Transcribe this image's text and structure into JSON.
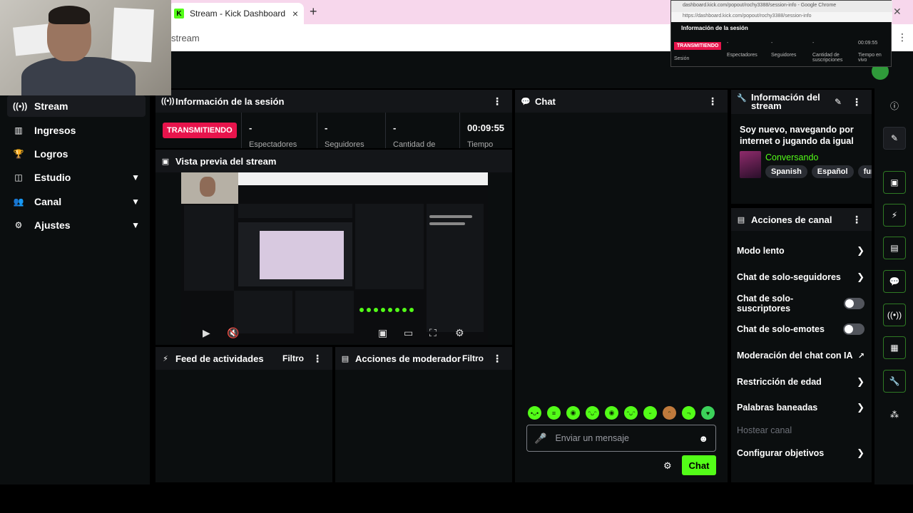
{
  "browser": {
    "tab_title": "Stream - Kick Dashboard",
    "tab_favicon": "K",
    "close": "×",
    "new_tab": "+",
    "url_fragment": "stream"
  },
  "popout": {
    "window_title": "dashboard.kick.com/popout/rochy3388/session-info - Google Chrome",
    "url": "https://dashboard.kick.com/popout/rochy3388/session-info",
    "header": "Información de la sesión",
    "status": "TRANSMITIENDO",
    "status_sub": "Sesión",
    "cells": [
      {
        "value": "-",
        "label": "Espectadores"
      },
      {
        "value": "-",
        "label": "Seguidores"
      },
      {
        "value": "-",
        "label": "Cantidad de suscripciones"
      },
      {
        "value": "00:09:55",
        "label": "Tiempo en vivo"
      }
    ]
  },
  "sidebar": {
    "items": [
      {
        "label": "Stream",
        "icon": "broadcast-icon",
        "glyph": "((•))"
      },
      {
        "label": "Ingresos",
        "icon": "chart-icon",
        "glyph": "▥"
      },
      {
        "label": "Logros",
        "icon": "trophy-icon",
        "glyph": "🏆"
      },
      {
        "label": "Estudio",
        "icon": "studio-icon",
        "glyph": "◫"
      },
      {
        "label": "Canal",
        "icon": "users-icon",
        "glyph": "👥"
      },
      {
        "label": "Ajustes",
        "icon": "gear-icon",
        "glyph": "⚙"
      }
    ]
  },
  "session": {
    "title": "Información de la sesión",
    "status": "TRANSMITIENDO",
    "cells": [
      {
        "value": "-",
        "label": "Espectadores"
      },
      {
        "value": "-",
        "label": "Seguidores"
      },
      {
        "value": "-",
        "label": "Cantidad de"
      },
      {
        "value": "00:09:55",
        "label": "Tiempo"
      }
    ]
  },
  "preview": {
    "title": "Vista previa del stream"
  },
  "activity": {
    "title": "Feed de actividades",
    "filter": "Filtro"
  },
  "moderator": {
    "title": "Acciones de moderador",
    "filter": "Filtro"
  },
  "chat": {
    "title": "Chat",
    "placeholder": "Enviar un mensaje",
    "send": "Chat",
    "emote_count": 10
  },
  "stream_info": {
    "title": "Información del stream",
    "stream_title": "Soy nuevo, navegando por internet o jugando da igual",
    "category": "Conversando",
    "tags": [
      "Spanish",
      "Español",
      "fur"
    ]
  },
  "channel_actions": {
    "title": "Acciones de canal",
    "items": [
      {
        "label": "Modo lento",
        "type": "chevron"
      },
      {
        "label": "Chat de solo-seguidores",
        "type": "chevron"
      },
      {
        "label": "Chat de solo-suscriptores",
        "type": "toggle"
      },
      {
        "label": "Chat de solo-emotes",
        "type": "toggle"
      },
      {
        "label": "Moderación del chat con IA",
        "type": "external"
      },
      {
        "label": "Restricción de edad",
        "type": "chevron"
      },
      {
        "label": "Palabras baneadas",
        "type": "chevron"
      },
      {
        "label": "Hostear canal",
        "type": "disabled"
      },
      {
        "label": "Configurar objetivos",
        "type": "chevron"
      }
    ]
  },
  "colors": {
    "accent": "#53fc18",
    "live": "#e8144c",
    "bg": "#0b0e0f",
    "panel_header": "#141619"
  }
}
